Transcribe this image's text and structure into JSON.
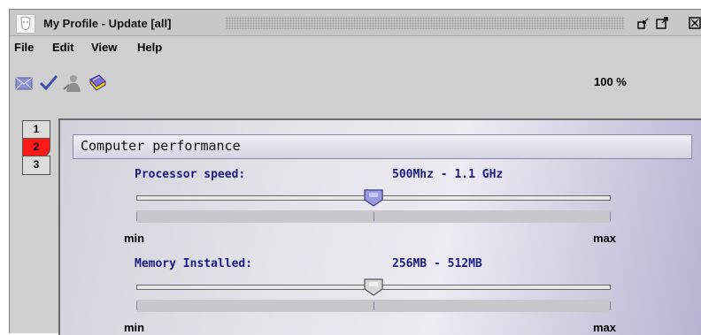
{
  "window": {
    "title": "My Profile - Update [all]",
    "icons": [
      "profile-face-icon",
      "minimize-icon",
      "maximize-icon",
      "close-icon"
    ]
  },
  "menu": {
    "items": [
      "File",
      "Edit",
      "View",
      "Help"
    ]
  },
  "toolbar": {
    "buttons": [
      "envelope-icon",
      "checkmark-icon",
      "person-icon",
      "book-icon"
    ],
    "zoom": "100 %"
  },
  "sidetabs": [
    {
      "label": "1",
      "active": false
    },
    {
      "label": "2",
      "active": true
    },
    {
      "label": "3",
      "active": false
    }
  ],
  "section": {
    "title": "Computer performance",
    "sliders": [
      {
        "label": "Processor speed:",
        "value": "500Mhz - 1.1 GHz",
        "min_label": "min",
        "max_label": "max",
        "position": 0.5
      },
      {
        "label": "Memory Installed:",
        "value": "256MB - 512MB",
        "min_label": "min",
        "max_label": "max",
        "position": 0.5
      }
    ]
  },
  "colors": {
    "active_tab": "#ff1a1a",
    "label_text": "#1a1a80",
    "panel_accent": "#b7b3d2"
  }
}
